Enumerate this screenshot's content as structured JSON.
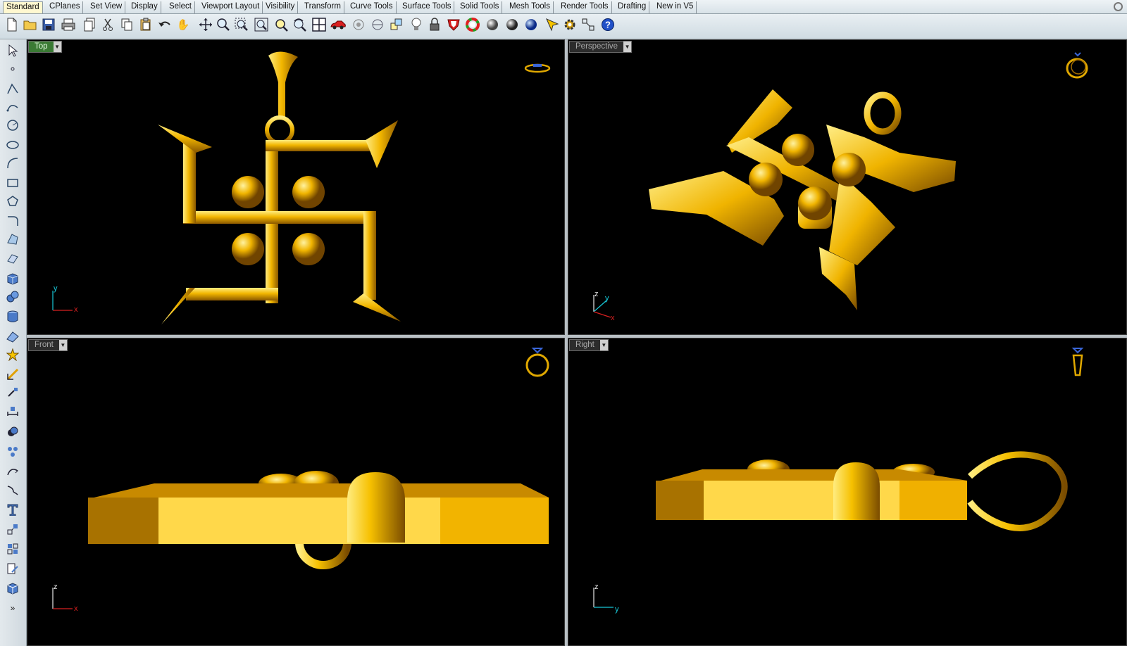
{
  "tabs": [
    {
      "label": "Standard",
      "active": true
    },
    {
      "label": "CPlanes"
    },
    {
      "label": "Set View"
    },
    {
      "label": "Display"
    },
    {
      "label": "Select"
    },
    {
      "label": "Viewport Layout"
    },
    {
      "label": "Visibility"
    },
    {
      "label": "Transform"
    },
    {
      "label": "Curve Tools"
    },
    {
      "label": "Surface Tools"
    },
    {
      "label": "Solid Tools"
    },
    {
      "label": "Mesh Tools"
    },
    {
      "label": "Render Tools"
    },
    {
      "label": "Drafting"
    },
    {
      "label": "New in V5"
    }
  ],
  "toolbar": {
    "icons": [
      "new-file-icon",
      "open-folder-icon",
      "save-icon",
      "print-icon",
      "copy-page-icon",
      "cut-icon",
      "copy-icon",
      "paste-icon",
      "undo-icon",
      "pan-hand-icon",
      "move-view-icon",
      "zoom-icon",
      "zoom-window-icon",
      "zoom-extents-icon",
      "zoom-selected-icon",
      "rotate-view-icon",
      "four-viewports-icon",
      "car-icon",
      "render-preview-icon",
      "named-cplane-icon",
      "layer-icon",
      "light-bulb-icon",
      "lock-icon",
      "shield-icon",
      "color-wheel-icon",
      "shaded-sphere-icon",
      "rendered-sphere-icon",
      "blue-sphere-icon",
      "select-filter-icon",
      "settings-gear-icon",
      "grid-snap-icon",
      "help-icon"
    ]
  },
  "left_toolbar": {
    "icons": [
      "select-arrow-icon",
      "point-icon",
      "polyline-icon",
      "curve-icon",
      "circle-icon",
      "ellipse-icon",
      "arc-icon",
      "rectangle-icon",
      "polygon-icon",
      "fillet-curve-icon",
      "surface-corner-icon",
      "extrude-surface-icon",
      "box-icon",
      "sphere-solid-icon",
      "cylinder-icon",
      "edit-points-icon",
      "star-icon",
      "transform-icon",
      "align-icon",
      "dimension-icon",
      "boolean-icon",
      "group-icon",
      "join-icon",
      "explode-icon",
      "text-icon",
      "array-icon",
      "analyze-icon",
      "block-icon",
      "render-cube-icon"
    ],
    "more_label": "»"
  },
  "viewports": [
    {
      "label": "Top",
      "active": true
    },
    {
      "label": "Perspective",
      "active": false
    },
    {
      "label": "Front",
      "active": false
    },
    {
      "label": "Right",
      "active": false
    }
  ],
  "axes": {
    "top": {
      "a": "y",
      "b": "x"
    },
    "perspective": {
      "a": "z",
      "b": "y",
      "c": "x"
    },
    "front": {
      "a": "z",
      "b": "x"
    },
    "right": {
      "a": "z",
      "b": "y"
    }
  },
  "colors": {
    "gold_light": "#ffdc3c",
    "gold_mid": "#f0b400",
    "gold_dark": "#a06a00",
    "axis_x": "#d82020",
    "axis_y": "#18c8d8",
    "axis_z": "#e8e8e8",
    "active_label": "#3a7a34"
  }
}
